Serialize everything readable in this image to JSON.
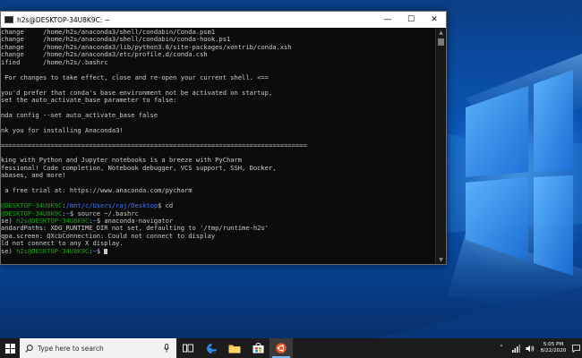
{
  "window": {
    "title": "h2s@DESKTOP-34U8K9C: ~",
    "minimize_glyph": "—",
    "maximize_glyph": "☐",
    "close_glyph": "✕"
  },
  "terminal": {
    "lines": [
      "change     /home/h2s/anaconda3/shell/condabin/Conda.psm1",
      "change     /home/h2s/anaconda3/shell/condabin/conda-hook.ps1",
      "change     /home/h2s/anaconda3/lib/python3.8/site-packages/xontrib/conda.xsh",
      "change     /home/h2s/anaconda3/etc/profile.d/conda.csh",
      "ified      /home/h2s/.bashrc",
      "",
      " For changes to take effect, close and re-open your current shell. <==",
      "",
      "you'd prefer that conda's base environment not be activated on startup,",
      "set the auto_activate_base parameter to false:",
      "",
      "nda config --set auto_activate_base false",
      "",
      "nk you for installing Anaconda3!",
      "",
      "================================================================================",
      "",
      "king with Python and Jupyter notebooks is a breeze with PyCharm",
      "fessional! Code completion, Notebook debugger, VCS support, SSH, Docker,",
      "abases, and more!",
      "",
      " a free trial at: https://www.anaconda.com/pycharm",
      ""
    ],
    "prompt1": {
      "user": "@DESKTOP-34U8K9C",
      "sep": ":",
      "path": "/mnt/c/Users/raj/Desktop",
      "rest": "$ cd"
    },
    "prompt2": {
      "user": "@DESKTOP-34U8K9C",
      "sep": ":",
      "path": "~",
      "rest": "$ source ~/.bashrc"
    },
    "prompt3": {
      "env": "se) ",
      "user": "h2s@DESKTOP-34U8K9C",
      "sep": ":",
      "path": "~",
      "rest": "$ anaconda-navigator"
    },
    "output": [
      "andardPaths: XDG_RUNTIME_DIR not set, defaulting to '/tmp/runtime-h2s'",
      "qpa.screen: QXcbConnection: Could not connect to display",
      "ld not connect to any X display."
    ],
    "prompt4": {
      "env": "se) ",
      "user": "h2s@DESKTOP-34U8K9C",
      "sep": ":",
      "path": "~",
      "rest": "$ "
    }
  },
  "taskbar": {
    "search_placeholder": "Type here to search",
    "time": "5:05 PM",
    "date": "8/22/2020"
  },
  "colors": {
    "prompt_green": "#13a10e",
    "path_blue": "#3b78ff",
    "taskbar": "#1c1c1c"
  }
}
